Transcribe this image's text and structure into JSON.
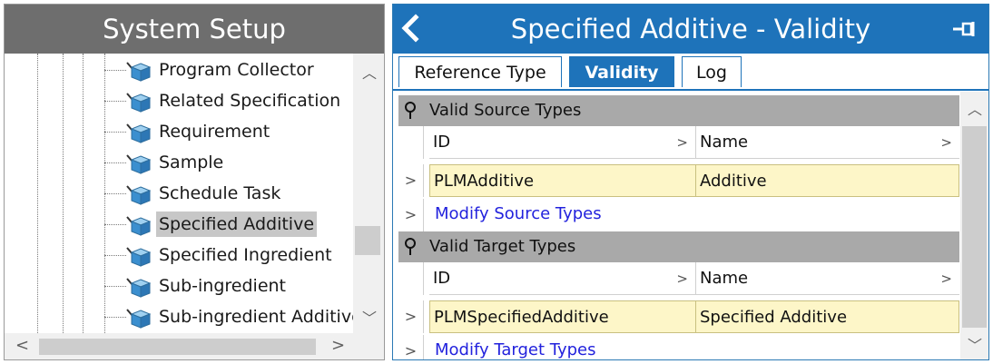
{
  "left_panel": {
    "title": "System Setup",
    "tree_items": [
      {
        "label": "Program Collector"
      },
      {
        "label": "Related Specification"
      },
      {
        "label": "Requirement"
      },
      {
        "label": "Sample"
      },
      {
        "label": "Schedule Task"
      },
      {
        "label": "Specified Additive",
        "selected": true
      },
      {
        "label": "Specified Ingredient"
      },
      {
        "label": "Sub-ingredient"
      },
      {
        "label": "Sub-ingredient Additive"
      }
    ]
  },
  "right_panel": {
    "title": "Specified Additive - Validity",
    "back_icon": "chevron-left-icon",
    "pin_icon": "pin-icon",
    "tabs": [
      {
        "label": "Reference Type",
        "active": false
      },
      {
        "label": "Validity",
        "active": true
      },
      {
        "label": "Log",
        "active": false
      }
    ],
    "sections": {
      "source": {
        "title": "Valid Source Types",
        "columns": [
          "ID",
          "Name"
        ],
        "rows": [
          {
            "id": "PLMAdditive",
            "name": "Additive"
          }
        ],
        "action_label": "Modify Source Types"
      },
      "target": {
        "title": "Valid Target Types",
        "columns": [
          "ID",
          "Name"
        ],
        "rows": [
          {
            "id": "PLMSpecifiedAdditive",
            "name": "Specified Additive"
          }
        ],
        "action_label": "Modify Target Types"
      }
    }
  },
  "colors": {
    "header_blue": "#1e73ba",
    "left_header_gray": "#6e6e6e",
    "section_gray": "#a9a9a9",
    "row_highlight": "#fdf6c8",
    "link_blue": "#2222dd"
  }
}
